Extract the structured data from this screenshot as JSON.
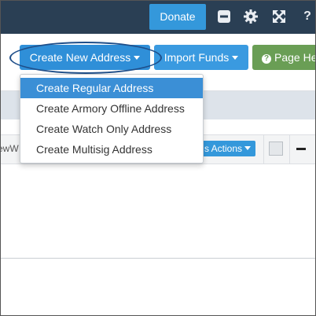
{
  "topbar": {
    "donate_label": "Donate",
    "icons": [
      "minimize-icon",
      "gear-icon",
      "expand-icon",
      "help-icon"
    ],
    "help_glyph": "?"
  },
  "toolbar": {
    "create_address_label": "Create New Address",
    "import_funds_label": "Import Funds",
    "page_help_label": "Page He",
    "page_help_glyph": "?"
  },
  "dropdown": {
    "items": [
      "Create Regular Address",
      "Create Armory Offline Address",
      "Create Watch Only Address",
      "Create Multisig Address"
    ],
    "highlighted_index": 0
  },
  "wallet_row": {
    "name": "ewW",
    "actions_label": "s Actions"
  },
  "colors": {
    "topbar_bg": "#2a3f54",
    "primary_blue": "#3498db",
    "help_green": "#6a9e55",
    "highlight": "#3b8fd6"
  }
}
